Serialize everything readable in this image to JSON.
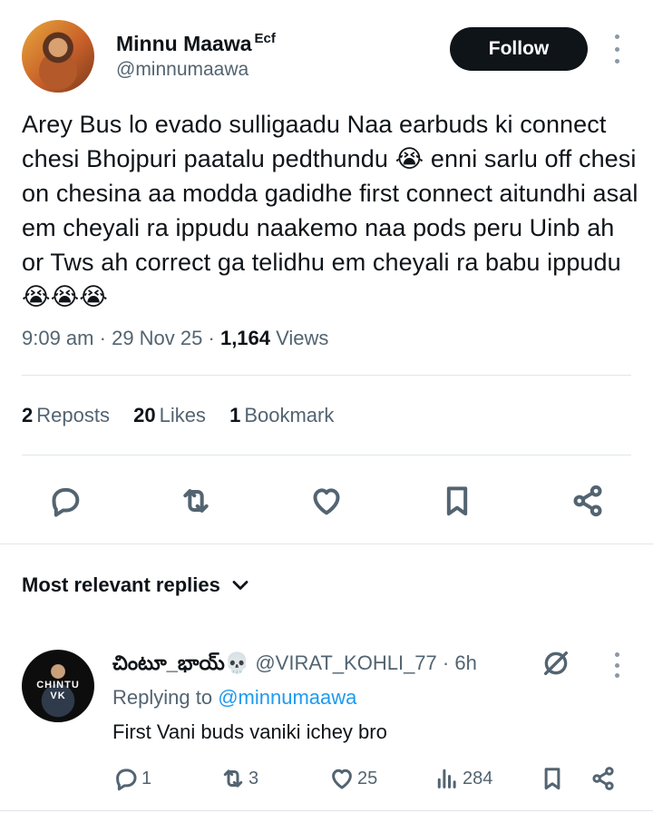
{
  "tweet": {
    "author": {
      "display_name": "Minnu Maawa",
      "suffix": "Ecf",
      "handle": "@minnumaawa"
    },
    "follow_label": "Follow",
    "text": "Arey Bus lo evado sulligaadu Naa earbuds ki connect chesi Bhojpuri paatalu pedthundu 😭 enni sarlu off chesi on chesina aa modda gadidhe first connect aitundhi asal em cheyali ra ippudu naakemo naa pods peru Uinb ah or Tws ah correct ga telidhu em cheyali ra babu ippudu 😭😭😭",
    "time": "9:09 am",
    "date": "29 Nov 25",
    "views_count": "1,164",
    "views_label": "Views",
    "stats": {
      "reposts_count": "2",
      "reposts_label": "Reposts",
      "likes_count": "20",
      "likes_label": "Likes",
      "bookmarks_count": "1",
      "bookmarks_label": "Bookmark"
    },
    "action_icons": [
      "reply-icon",
      "repost-icon",
      "like-icon",
      "bookmark-icon",
      "share-icon"
    ]
  },
  "replies_section": {
    "sort_label": "Most relevant replies"
  },
  "reply": {
    "display_name": "చింటూ_భాయ్💀",
    "handle": "@VIRAT_KOHLI_77",
    "age": "6h",
    "avatar_text": "CHINTU VK",
    "replying_prefix": "Replying to",
    "replying_to": "@minnumaawa",
    "text": "First Vani buds vaniki ichey bro",
    "counts": {
      "replies": "1",
      "reposts": "3",
      "likes": "25",
      "views": "284"
    }
  },
  "colors": {
    "text_primary": "#0f1419",
    "text_secondary": "#536471",
    "link": "#1d9bf0",
    "divider": "#e1e6ea",
    "button_dark": "#0f1419"
  }
}
